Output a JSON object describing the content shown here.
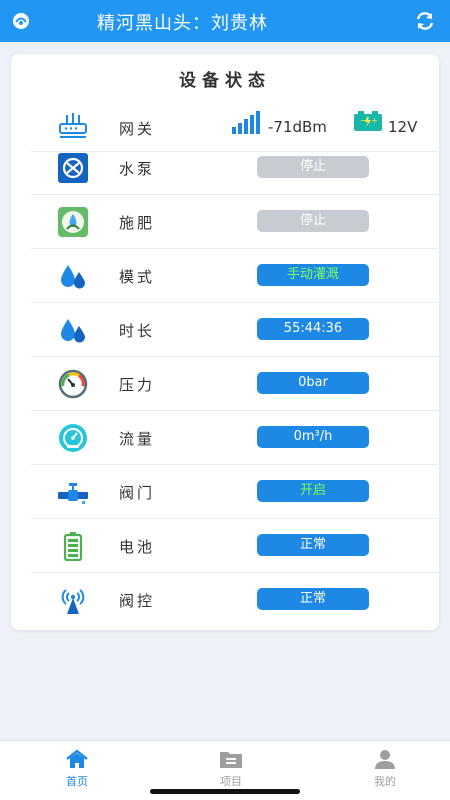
{
  "header": {
    "title": "精河黑山头：刘贵林"
  },
  "card": {
    "title": "设备状态"
  },
  "gateway": {
    "label": "网关",
    "signal": "-71dBm",
    "voltage": "12V"
  },
  "rows": [
    {
      "label": "水泵",
      "value": "停止",
      "icon": "pump-icon"
    },
    {
      "label": "施肥",
      "value": "停止",
      "icon": "fertilizer-icon"
    },
    {
      "label": "模式",
      "value": "手动灌溉",
      "icon": "water-drops-icon"
    },
    {
      "label": "时长",
      "value": "55:44:36",
      "icon": "water-drops-icon"
    },
    {
      "label": "压力",
      "value": "0bar",
      "icon": "pressure-gauge-icon"
    },
    {
      "label": "流量",
      "value": "0m³/h",
      "icon": "flow-gauge-icon"
    },
    {
      "label": "阀门",
      "value": "开启",
      "icon": "valve-icon"
    },
    {
      "label": "电池",
      "value": "正常",
      "icon": "battery-icon"
    },
    {
      "label": "阀控",
      "value": "正常",
      "icon": "antenna-icon"
    }
  ],
  "tabs": [
    {
      "label": "首页",
      "icon": "home-icon"
    },
    {
      "label": "项目",
      "icon": "folder-icon"
    },
    {
      "label": "我的",
      "icon": "user-icon"
    }
  ],
  "colors": {
    "primary": "#2196f3",
    "active_tab": "#1e88e5",
    "inactive_tab": "#9e9e9e",
    "status_off": "#c7cbd2",
    "mode_text": "#7cff5a"
  }
}
